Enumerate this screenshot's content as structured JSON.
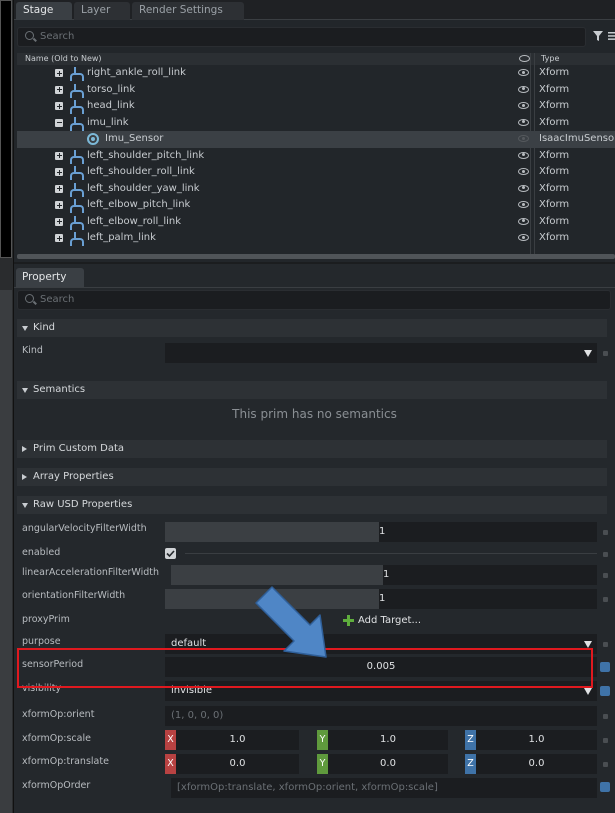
{
  "stage": {
    "tabs": [
      "Stage",
      "Layer",
      "Render Settings"
    ],
    "search_placeholder": "Search",
    "columns": {
      "name": "Name (Old to New)",
      "type": "Type"
    },
    "rows": [
      {
        "name": "right_ankle_roll_link",
        "type": "Xform"
      },
      {
        "name": "torso_link",
        "type": "Xform"
      },
      {
        "name": "head_link",
        "type": "Xform"
      },
      {
        "name": "imu_link",
        "type": "Xform"
      },
      {
        "name": "Imu_Sensor",
        "type": "IsaacImuSensor"
      },
      {
        "name": "left_shoulder_pitch_link",
        "type": "Xform"
      },
      {
        "name": "left_shoulder_roll_link",
        "type": "Xform"
      },
      {
        "name": "left_shoulder_yaw_link",
        "type": "Xform"
      },
      {
        "name": "left_elbow_pitch_link",
        "type": "Xform"
      },
      {
        "name": "left_elbow_roll_link",
        "type": "Xform"
      },
      {
        "name": "left_palm_link",
        "type": "Xform"
      }
    ]
  },
  "property": {
    "tab": "Property",
    "search_placeholder": "Search",
    "kind_section": "Kind",
    "kind_label": "Kind",
    "kind_value": "",
    "semantics_section": "Semantics",
    "semantics_note": "This prim has no semantics",
    "prim_custom_data": "Prim Custom Data",
    "array_properties": "Array Properties",
    "raw_usd": "Raw USD Properties",
    "fields": {
      "angular_label": "angularVelocityFilterWidth",
      "angular_value": "1",
      "enabled_label": "enabled",
      "linear_label": "linearAccelerationFilterWidth",
      "linear_value": "1",
      "orientation_label": "orientationFilterWidth",
      "orientation_value": "1",
      "proxy_label": "proxyPrim",
      "proxy_button": "Add Target...",
      "purpose_label": "purpose",
      "purpose_value": "default",
      "sensor_label": "sensorPeriod",
      "sensor_value": "0.005",
      "visibility_label": "visibility",
      "visibility_value": "invisible",
      "orient_label": "xformOp:orient",
      "orient_value": "(1, 0, 0, 0)",
      "scale_label": "xformOp:scale",
      "scale_x": "1.0",
      "scale_y": "1.0",
      "scale_z": "1.0",
      "translate_label": "xformOp:translate",
      "translate_x": "0.0",
      "translate_y": "0.0",
      "translate_z": "0.0",
      "order_label": "xformOpOrder",
      "order_value": "[xformOp:translate, xformOp:orient, xformOp:scale]"
    },
    "axes": [
      "X",
      "Y",
      "Z"
    ]
  }
}
